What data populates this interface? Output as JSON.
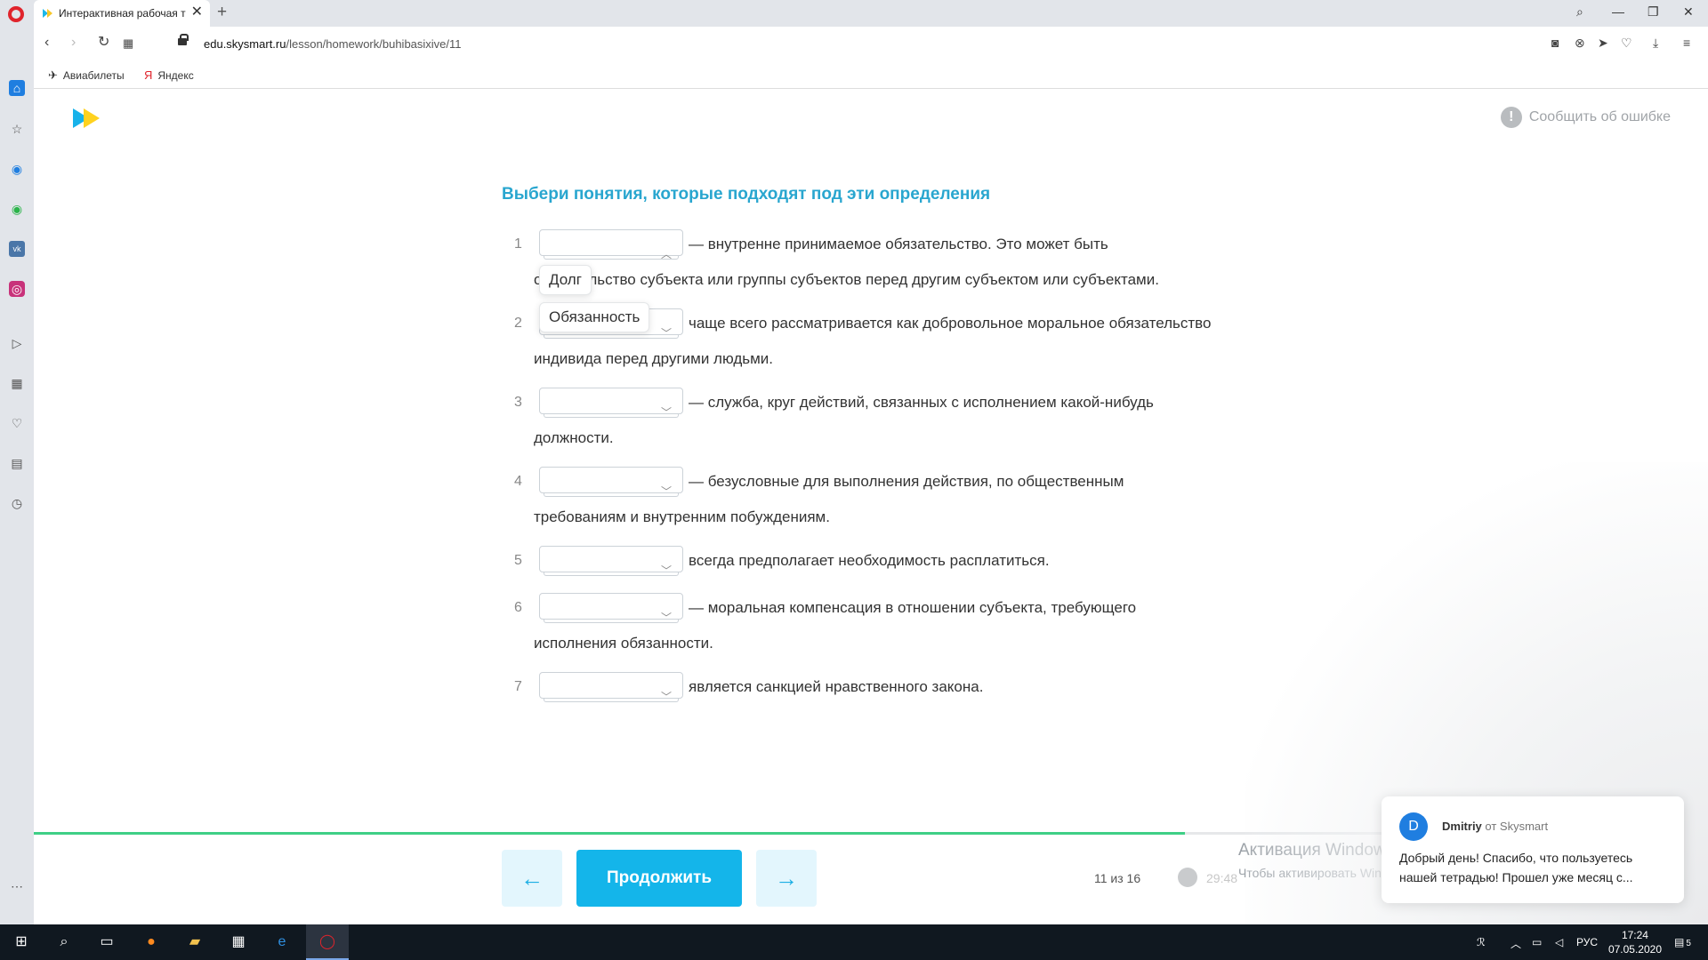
{
  "browser": {
    "tab_title": "Интерактивная рабочая т",
    "tab_close": "✕",
    "new_tab": "+",
    "url_domain": "edu.skysmart.ru",
    "url_path": "/lesson/homework/buhibasixive/11",
    "bookmarks": [
      {
        "label": "Авиабилеты",
        "icon": "airplane-icon"
      },
      {
        "label": "Яндекс",
        "icon": "yandex-icon"
      }
    ]
  },
  "page": {
    "report_label": "Сообщить об ошибке",
    "task_title": "Выбери понятия, которые подходят под эти определения",
    "questions": [
      {
        "num": "1",
        "line1": "— внутренне принимаемое обязательство. Это может быть",
        "line2": "обязательство субъекта или группы субъектов перед другим субъектом или субъектами."
      },
      {
        "num": "2",
        "line1": "чаще всего рассматривается как добровольное моральное обязательство",
        "line2": "индивида перед другими людьми."
      },
      {
        "num": "3",
        "line1": "— служба, круг действий, связанных с исполнением какой-нибудь",
        "line2": "должности."
      },
      {
        "num": "4",
        "line1": "— безусловные для выполнения действия, по общественным",
        "line2": "требованиям и внутренним побуждениям."
      },
      {
        "num": "5",
        "line1": "всегда предполагает необходимость расплатиться.",
        "line2": ""
      },
      {
        "num": "6",
        "line1": "— моральная компенсация в отношении субъекта, требующего",
        "line2": "исполнения обязанности."
      },
      {
        "num": "7",
        "line1": "является санкцией нравственного закона.",
        "line2": ""
      }
    ],
    "dropdown_options": [
      "Долг",
      "Обязанность"
    ]
  },
  "footer": {
    "prev_arrow": "←",
    "next_arrow": "→",
    "continue_label": "Продолжить",
    "page_counter": "11 из 16",
    "timer": "29:48",
    "progress_fraction": 0.6875,
    "windows_activation_title": "Активация Windows",
    "windows_activation_text": "Чтобы активировать Windows, перейдите в раздел \"Параметры\"."
  },
  "chat": {
    "avatar_letter": "D",
    "sender": "Dmitriy",
    "from_text": "от Skysmart",
    "message": "Добрый день! Спасибо, что пользуетесь нашей тетрадью! Прошел уже месяц с..."
  },
  "taskbar": {
    "language": "РУС",
    "time": "17:24",
    "date": "07.05.2020",
    "notification_count": "5"
  },
  "colors": {
    "accent": "#14b5ea",
    "title_blue": "#29a6cf",
    "progress_green": "#3ecf86",
    "brand_yellow": "#ffd21f"
  }
}
